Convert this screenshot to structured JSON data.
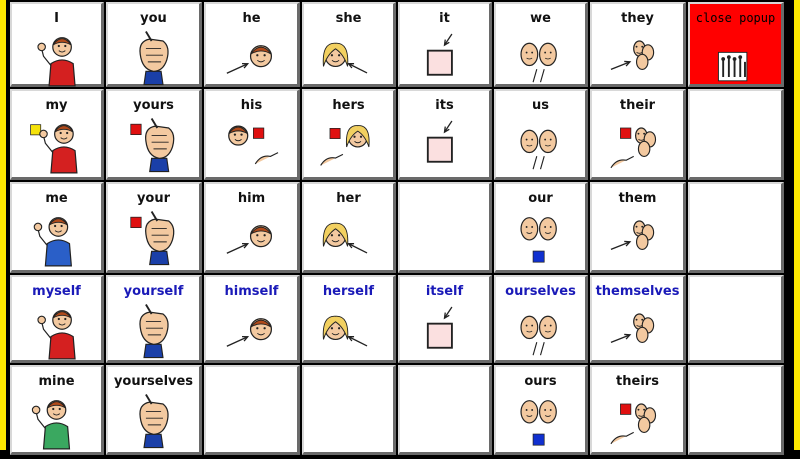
{
  "cells": [
    {
      "row": 0,
      "col": 0,
      "label": "I",
      "icon": "self-icon"
    },
    {
      "row": 0,
      "col": 1,
      "label": "you",
      "icon": "pointing-fist-icon"
    },
    {
      "row": 0,
      "col": 2,
      "label": "he",
      "icon": "boy-arrow-icon"
    },
    {
      "row": 0,
      "col": 3,
      "label": "she",
      "icon": "girl-arrow-icon"
    },
    {
      "row": 0,
      "col": 4,
      "label": "it",
      "icon": "box-arrow-icon"
    },
    {
      "row": 0,
      "col": 5,
      "label": "we",
      "icon": "two-faces-icon"
    },
    {
      "row": 0,
      "col": 6,
      "label": "they",
      "icon": "group-arrow-icon"
    },
    {
      "row": 0,
      "col": 7,
      "label": "close popup",
      "icon": "close-popup-icon",
      "popup": true
    },
    {
      "row": 1,
      "col": 0,
      "label": "my",
      "icon": "self-possessive-icon"
    },
    {
      "row": 1,
      "col": 1,
      "label": "yours",
      "icon": "pointing-fist-possessive-icon"
    },
    {
      "row": 1,
      "col": 2,
      "label": "his",
      "icon": "boy-possessive-icon"
    },
    {
      "row": 1,
      "col": 3,
      "label": "hers",
      "icon": "girl-possessive-icon"
    },
    {
      "row": 1,
      "col": 4,
      "label": "its",
      "icon": "box-arrow-icon"
    },
    {
      "row": 1,
      "col": 5,
      "label": "us",
      "icon": "two-faces-icon"
    },
    {
      "row": 1,
      "col": 6,
      "label": "their",
      "icon": "group-possessive-icon"
    },
    {
      "row": 1,
      "col": 7,
      "label": "",
      "icon": ""
    },
    {
      "row": 2,
      "col": 0,
      "label": "me",
      "icon": "self-blue-icon"
    },
    {
      "row": 2,
      "col": 1,
      "label": "your",
      "icon": "pointing-fist-possessive-icon"
    },
    {
      "row": 2,
      "col": 2,
      "label": "him",
      "icon": "boy-arrow-icon"
    },
    {
      "row": 2,
      "col": 3,
      "label": "her",
      "icon": "girl-arrow-icon"
    },
    {
      "row": 2,
      "col": 4,
      "label": "",
      "icon": ""
    },
    {
      "row": 2,
      "col": 5,
      "label": "our",
      "icon": "two-faces-blue-square-icon"
    },
    {
      "row": 2,
      "col": 6,
      "label": "them",
      "icon": "group-arrow-icon"
    },
    {
      "row": 2,
      "col": 7,
      "label": "",
      "icon": ""
    },
    {
      "row": 3,
      "col": 0,
      "label": "myself",
      "icon": "self-icon",
      "blue": true
    },
    {
      "row": 3,
      "col": 1,
      "label": "yourself",
      "icon": "pointing-fist-icon",
      "blue": true
    },
    {
      "row": 3,
      "col": 2,
      "label": "himself",
      "icon": "boy-arrow-icon",
      "blue": true
    },
    {
      "row": 3,
      "col": 3,
      "label": "herself",
      "icon": "girl-arrow-icon",
      "blue": true
    },
    {
      "row": 3,
      "col": 4,
      "label": "itself",
      "icon": "box-arrow-icon",
      "blue": true
    },
    {
      "row": 3,
      "col": 5,
      "label": "ourselves",
      "icon": "two-faces-icon",
      "blue": true
    },
    {
      "row": 3,
      "col": 6,
      "label": "themselves",
      "icon": "group-arrow-icon",
      "blue": true
    },
    {
      "row": 3,
      "col": 7,
      "label": "",
      "icon": ""
    },
    {
      "row": 4,
      "col": 0,
      "label": "mine",
      "icon": "self-green-icon"
    },
    {
      "row": 4,
      "col": 1,
      "label": "yourselves",
      "icon": "pointing-fist-icon"
    },
    {
      "row": 4,
      "col": 2,
      "label": "",
      "icon": ""
    },
    {
      "row": 4,
      "col": 3,
      "label": "",
      "icon": ""
    },
    {
      "row": 4,
      "col": 4,
      "label": "",
      "icon": ""
    },
    {
      "row": 4,
      "col": 5,
      "label": "ours",
      "icon": "two-faces-blue-square-icon"
    },
    {
      "row": 4,
      "col": 6,
      "label": "theirs",
      "icon": "group-possessive-icon"
    },
    {
      "row": 4,
      "col": 7,
      "label": "",
      "icon": ""
    }
  ],
  "colors": {
    "frame": "#ffe800",
    "cell_bg": "#ffffff",
    "popup_bg": "#ff0000",
    "reflexive_text": "#1a1ab8",
    "label_text": "#111111"
  }
}
